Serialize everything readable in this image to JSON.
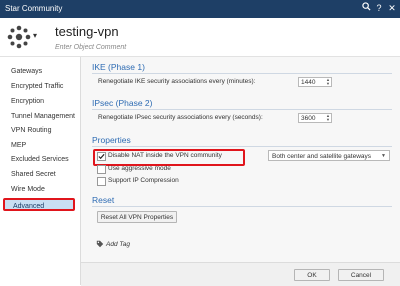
{
  "window": {
    "title": "Star Community"
  },
  "header": {
    "object_name": "testing-vpn",
    "comment_placeholder": "Enter Object Comment"
  },
  "sidebar": {
    "items": [
      {
        "label": "Gateways"
      },
      {
        "label": "Encrypted Traffic"
      },
      {
        "label": "Encryption"
      },
      {
        "label": "Tunnel Management"
      },
      {
        "label": "VPN Routing"
      },
      {
        "label": "MEP"
      },
      {
        "label": "Excluded Services"
      },
      {
        "label": "Shared Secret"
      },
      {
        "label": "Wire Mode"
      },
      {
        "label": "Advanced",
        "selected": true
      }
    ]
  },
  "ike": {
    "title": "IKE (Phase 1)",
    "label": "Renegotiate IKE security associations every (minutes):",
    "value": "1440"
  },
  "ipsec": {
    "title": "IPsec (Phase 2)",
    "label": "Renegotiate IPsec security associations every (seconds):",
    "value": "3600"
  },
  "properties": {
    "title": "Properties",
    "disable_nat": {
      "label": "Disable NAT inside the VPN community",
      "checked": true
    },
    "nat_scope": {
      "value": "Both center and satellite gateways"
    },
    "aggressive": {
      "label": "Use aggressive mode",
      "checked": false
    },
    "ip_compression": {
      "label": "Support IP Compression",
      "checked": false
    }
  },
  "reset": {
    "title": "Reset",
    "button_label": "Reset All VPN Properties"
  },
  "tags": {
    "add_label": "Add Tag"
  },
  "footer": {
    "ok_label": "OK",
    "cancel_label": "Cancel"
  },
  "colors": {
    "titlebar": "#1e3f66",
    "accent": "#2d6bb3",
    "highlight": "#e0151c",
    "selected": "#c9dff3"
  }
}
